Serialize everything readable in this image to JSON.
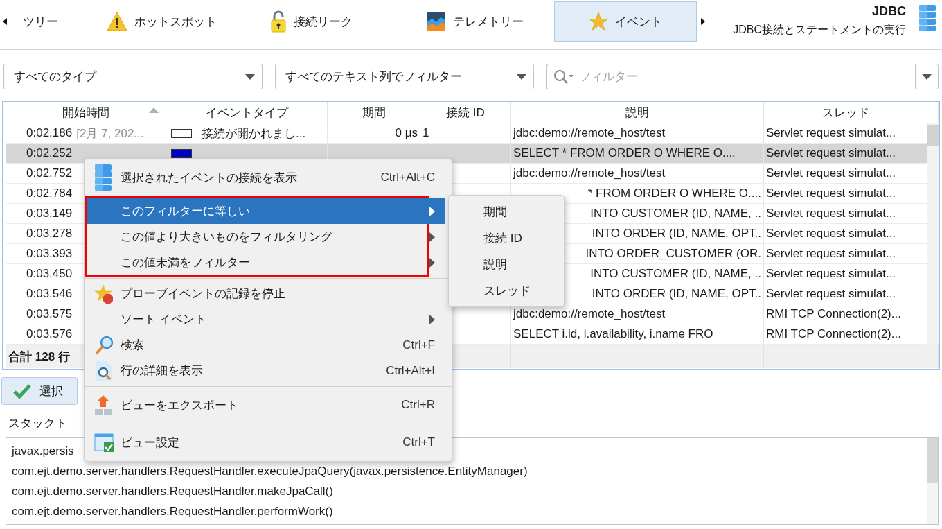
{
  "view_tabs": {
    "items": [
      {
        "label": "ツリー",
        "selected": false
      },
      {
        "label": "ホットスポット",
        "selected": false
      },
      {
        "label": "接続リーク",
        "selected": false
      },
      {
        "label": "テレメトリー",
        "selected": false
      },
      {
        "label": "イベント",
        "selected": true
      }
    ]
  },
  "header": {
    "title": "JDBC",
    "subtitle": "JDBC接続とステートメントの実行"
  },
  "filters": {
    "type_dropdown": "すべてのタイプ",
    "column_dropdown": "すべてのテキスト列でフィルター",
    "search": {
      "placeholder": "フィルター"
    }
  },
  "table": {
    "columns": [
      {
        "label": "開始時間",
        "sorted": true
      },
      {
        "label": "イベントタイプ",
        "sorted": false
      },
      {
        "label": "期間",
        "sorted": false
      },
      {
        "label": "接続 ID",
        "sorted": false
      },
      {
        "label": "説明",
        "sorted": false
      },
      {
        "label": "スレッド",
        "sorted": false
      }
    ],
    "rows": [
      {
        "selected": false,
        "time": "0:02.186",
        "date": "[2月 7, 202...",
        "color": "#ffffff",
        "type": "接続が開かれまし...",
        "duration": "0 μs",
        "connection_id": "1",
        "description": "jdbc:demo://remote_host/test",
        "thread": "Servlet request simulat..."
      },
      {
        "selected": true,
        "time": "0:02.252",
        "color": "#0000c8",
        "description": "SELECT * FROM ORDER O WHERE O....",
        "thread": "Servlet request simulat..."
      },
      {
        "selected": false,
        "time": "0:02.752",
        "description": "jdbc:demo://remote_host/test",
        "thread": "Servlet request simulat..."
      },
      {
        "selected": false,
        "time": "0:02.784",
        "description": "* FROM ORDER O WHERE O....",
        "thread": "Servlet request simulat..."
      },
      {
        "selected": false,
        "time": "0:03.149",
        "description": "INTO CUSTOMER (ID, NAME, ..",
        "thread": "Servlet request simulat..."
      },
      {
        "selected": false,
        "time": "0:03.278",
        "description": "INTO ORDER (ID, NAME, OPT..",
        "thread": "Servlet request simulat..."
      },
      {
        "selected": false,
        "time": "0:03.393",
        "description": "INTO ORDER_CUSTOMER (OR.",
        "thread": "Servlet request simulat..."
      },
      {
        "selected": false,
        "time": "0:03.450",
        "description": "INTO CUSTOMER (ID, NAME, ..",
        "thread": "Servlet request simulat..."
      },
      {
        "selected": false,
        "time": "0:03.546",
        "description": "INTO ORDER (ID, NAME, OPT..",
        "thread": "Servlet request simulat..."
      },
      {
        "selected": false,
        "time": "0:03.575",
        "description": "jdbc:demo://remote_host/test",
        "thread": "RMI TCP Connection(2)..."
      },
      {
        "selected": false,
        "time": "0:03.576",
        "description": "SELECT i.id, i.availability, i.name FRO",
        "thread": "RMI TCP Connection(2)..."
      }
    ],
    "total": "合計 128 行"
  },
  "select_button": {
    "label": "選択"
  },
  "stack_trace": {
    "label": "スタックト",
    "lines": [
      "javax.persis",
      "com.ejt.demo.server.handlers.RequestHandler.executeJpaQuery(javax.persistence.EntityManager)",
      "com.ejt.demo.server.handlers.RequestHandler.makeJpaCall()",
      "com.ejt.demo.server.handlers.RequestHandler.performWork()"
    ]
  },
  "context_menu": {
    "sections": [
      {
        "outlined": false,
        "items": [
          {
            "kind": "command",
            "label": "選択されたイベントの接続を表示",
            "shortcut": "Ctrl+Alt+C",
            "selected": false
          }
        ]
      },
      {
        "outlined": true,
        "items": [
          {
            "kind": "submenu",
            "label": "このフィルターに等しい",
            "selected": true
          },
          {
            "kind": "submenu",
            "label": "この値より大きいものをフィルタリング",
            "selected": false
          },
          {
            "kind": "submenu",
            "label": "この値未満をフィルター",
            "selected": false
          }
        ]
      },
      {
        "outlined": false,
        "items": [
          {
            "kind": "command",
            "label": "プローブイベントの記録を停止",
            "selected": false
          },
          {
            "kind": "submenu",
            "label": "ソート イベント",
            "selected": false
          },
          {
            "kind": "command",
            "label": "検索",
            "shortcut": "Ctrl+F",
            "selected": false
          },
          {
            "kind": "command",
            "label": "行の詳細を表示",
            "shortcut": "Ctrl+Alt+I",
            "selected": false
          }
        ]
      },
      {
        "outlined": false,
        "items": [
          {
            "kind": "command",
            "label": "ビューをエクスポート",
            "shortcut": "Ctrl+R",
            "selected": false
          }
        ]
      },
      {
        "outlined": false,
        "items": [
          {
            "kind": "command",
            "label": "ビュー設定",
            "shortcut": "Ctrl+T",
            "selected": false
          }
        ]
      }
    ],
    "submenu": {
      "items": [
        {
          "label": "期間"
        },
        {
          "label": "接続 ID"
        },
        {
          "label": "説明"
        },
        {
          "label": "スレッド"
        }
      ]
    }
  }
}
